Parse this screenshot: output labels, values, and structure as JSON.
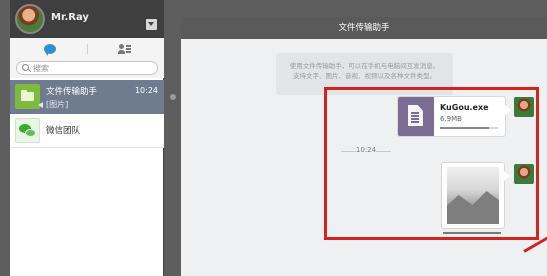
{
  "profile": {
    "name": "Mr.Ray"
  },
  "search": {
    "placeholder": "搜索"
  },
  "conversations": [
    {
      "name": "文件传输助手",
      "time": "10:24",
      "preview": "[图片]"
    },
    {
      "name": "微信团队"
    }
  ],
  "chat": {
    "title": "文件传输助手",
    "notice_lines": [
      "使用文件传输助手，可以在手机与电脑间互发消息。",
      "支持文字、图片、音视、视频以及各种文件类型。"
    ],
    "timestamp": "10:24",
    "file": {
      "name": "KuGou.exe",
      "size": "6.9MB",
      "progress": 0.85
    }
  },
  "colors": {
    "highlight": "#d22323",
    "active_item": "#6f7c90",
    "file_accent": "#7d6d95"
  },
  "icons": [
    "chat-bubble-icon",
    "contacts-icon",
    "search-icon",
    "file-icon",
    "dropdown-icon"
  ]
}
